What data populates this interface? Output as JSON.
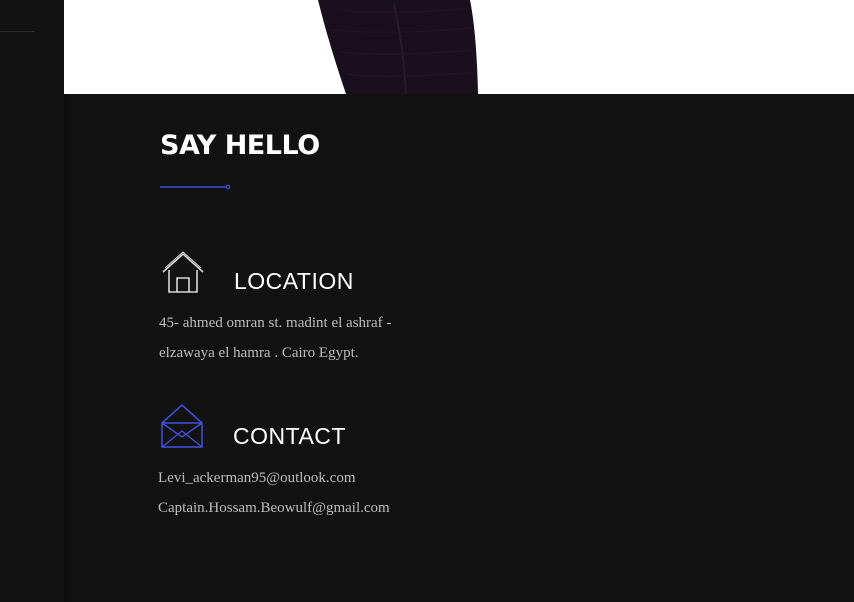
{
  "colors": {
    "accent": "#3e4fd1",
    "background": "#121212",
    "heading": "#ffffff",
    "body_text": "#bdbdbd"
  },
  "section": {
    "title": "SAY HELLO"
  },
  "location": {
    "icon": "house-icon",
    "heading": "LOCATION",
    "lines": [
      "45- ahmed omran st. madint el ashraf -",
      "elzawaya el hamra . Cairo Egypt."
    ]
  },
  "contact": {
    "icon": "envelope-icon",
    "heading": "CONTACT",
    "emails": [
      "Levi_ackerman95@outlook.com",
      "Captain.Hossam.Beowulf@gmail.com"
    ]
  }
}
